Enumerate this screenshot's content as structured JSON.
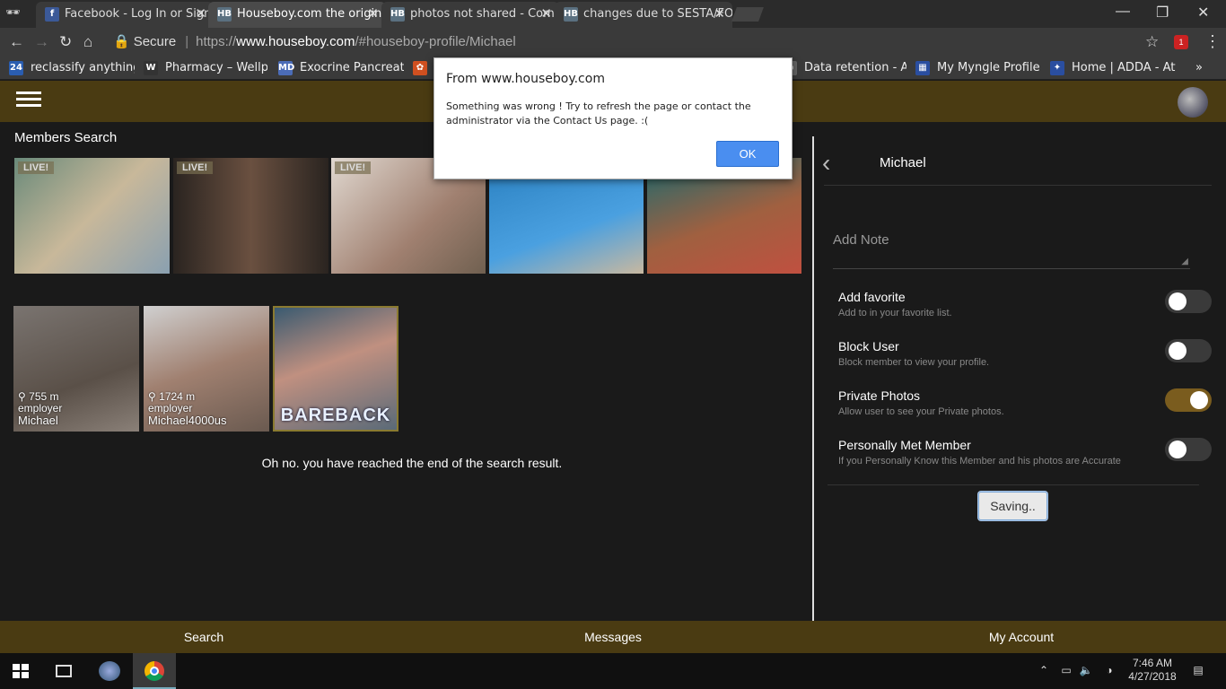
{
  "browser": {
    "tabs": [
      {
        "label": "Facebook - Log In or Sign Up",
        "favicon": "f",
        "color": "#3b5998"
      },
      {
        "label": "Houseboy.com the original",
        "favicon": "HB",
        "color": "#5a7080"
      },
      {
        "label": "photos not shared - Com",
        "favicon": "HB",
        "color": "#5a7080"
      },
      {
        "label": "changes due to SESTA/FO",
        "favicon": "HB",
        "color": "#5a7080"
      }
    ],
    "secure_label": "Secure",
    "url_scheme": "https://",
    "url_host": "www.houseboy.com",
    "url_path": "/#houseboy-profile/Michael",
    "ext_badge": "1"
  },
  "bookmarks": [
    {
      "label": "reclassify anything th",
      "icon": "24",
      "color": "#2a5db0"
    },
    {
      "label": "Pharmacy – Wellpartn",
      "icon": "W",
      "color": "#333"
    },
    {
      "label": "Exocrine Pancreatic In",
      "icon": "MD",
      "color": "#4b6cb7"
    },
    {
      "label": "",
      "icon": "✿",
      "color": "#d05020"
    },
    {
      "label": "Data retention - Anal",
      "icon": "◉",
      "color": "#666"
    },
    {
      "label": "My Myngle Profile | C",
      "icon": "▦",
      "color": "#2a4ea0"
    },
    {
      "label": "Home | ADDA - Atten",
      "icon": "✦",
      "color": "#2a4ea0"
    }
  ],
  "left": {
    "title": "Members Search",
    "live_label": "LIVE!",
    "cards": [
      {
        "distance": "755 m",
        "role": "employer",
        "name": "Michael"
      },
      {
        "distance": "1724 m",
        "role": "employer",
        "name": "Michael4000us"
      }
    ],
    "promo_text": "BAREBACK",
    "end_message": "Oh no. you have reached the end of the search result."
  },
  "profile": {
    "name": "Michael",
    "note_placeholder": "Add Note",
    "options": [
      {
        "title": "Add favorite",
        "subtitle": "Add to in your favorite list.",
        "on": false
      },
      {
        "title": "Block User",
        "subtitle": "Block member to view your profile.",
        "on": false
      },
      {
        "title": "Private Photos",
        "subtitle": "Allow user to see your Private photos.",
        "on": true
      },
      {
        "title": "Personally Met Member",
        "subtitle": "If you Personally Know this Member and his photos are Accurate",
        "on": false
      }
    ],
    "saving_label": "Saving.."
  },
  "footer": {
    "search": "Search",
    "messages": "Messages",
    "account": "My Account"
  },
  "dialog": {
    "title": "From www.houseboy.com",
    "message": "Something was wrong ! Try to refresh the page or contact the administrator via the Contact Us page. :(",
    "ok_label": "OK"
  },
  "taskbar": {
    "time": "7:46 AM",
    "date": "4/27/2018"
  }
}
